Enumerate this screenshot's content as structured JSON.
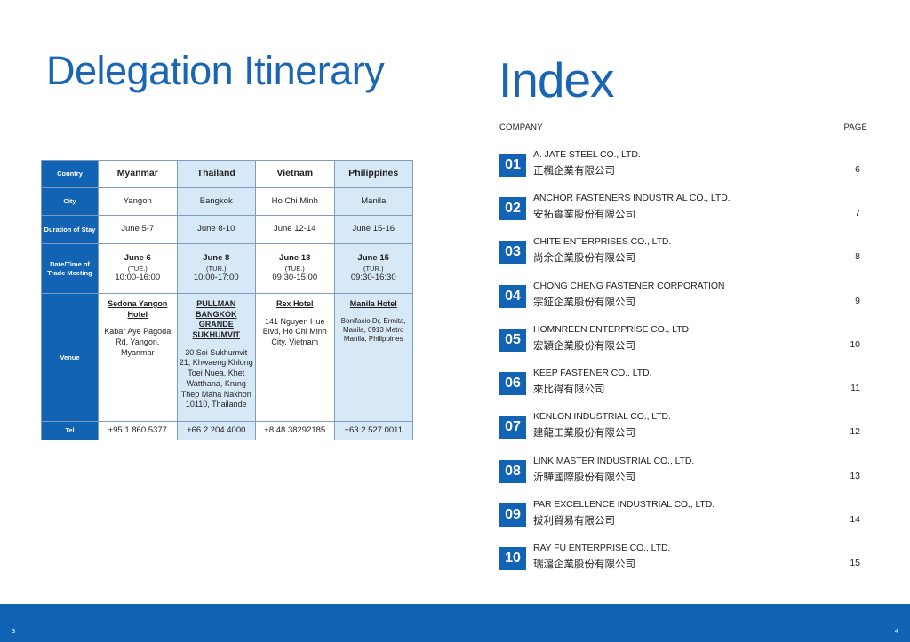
{
  "itinerary": {
    "title": "Delegation Itinerary",
    "row_labels": {
      "country": "Country",
      "city": "City",
      "duration": "Duration of Stay",
      "date_time": "Date/Time of Trade Meeting",
      "venue": "Venue",
      "tel": "Tel"
    },
    "columns": [
      {
        "country": "Myanmar",
        "city": "Yangon",
        "duration": "June 5-7",
        "date": "June 6",
        "weekday": "(TUE.)",
        "time": "10:00-16:00",
        "hotel": "Sedona Yangon Hotel",
        "address": "Kabar Aye Pagoda Rd, Yangon, Myanmar",
        "tel": "+95 1 860 5377"
      },
      {
        "country": "Thailand",
        "city": "Bangkok",
        "duration": "June 8-10",
        "date": "June 8",
        "weekday": "(TUR.)",
        "time": "10:00-17:00",
        "hotel": "PULLMAN BANGKOK GRANDE SUKHUMVIT",
        "address": "30 Soi Sukhumvit 21, Khwaeng Khlong Toei Nuea, Khet Watthana, Krung Thep Maha Nakhon 10110, Thailande",
        "tel": "+66 2 204 4000"
      },
      {
        "country": "Vietnam",
        "city": "Ho Chi Minh",
        "duration": "June 12-14",
        "date": "June 13",
        "weekday": "(TUE.)",
        "time": "09:30-15:00",
        "hotel": "Rex Hotel",
        "address": "141 Nguyen Hue Blvd, Ho Chi Minh City, Vietnam",
        "tel": "+8 48 38292185"
      },
      {
        "country": "Philippines",
        "city": "Manila",
        "duration": "June 15-16",
        "date": "June 15",
        "weekday": "(TUR.)",
        "time": "09:30-16:30",
        "hotel": "Manila Hotel",
        "address": "Bonifacio Dr, Ermita, Manila, 0913 Metro Manila, Philippines",
        "tel": "+63 2 527 0011"
      }
    ]
  },
  "index": {
    "title": "Index",
    "col_company": "COMPANY",
    "col_page": "PAGE",
    "entries": [
      {
        "num": "01",
        "en": "A. JATE STEEL CO., LTD.",
        "zh": "正楓企業有限公司",
        "page": "6"
      },
      {
        "num": "02",
        "en": "ANCHOR FASTENERS INDUSTRIAL CO., LTD.",
        "zh": "安拓實業股份有限公司",
        "page": "7"
      },
      {
        "num": "03",
        "en": "CHITE ENTERPRISES CO., LTD.",
        "zh": "尚余企業股份有限公司",
        "page": "8"
      },
      {
        "num": "04",
        "en": "CHONG CHENG FASTENER CORPORATION",
        "zh": "宗鉦企業股份有限公司",
        "page": "9"
      },
      {
        "num": "05",
        "en": "HOMNREEN ENTERPRISE CO., LTD.",
        "zh": "宏穎企業股份有限公司",
        "page": "10"
      },
      {
        "num": "06",
        "en": "KEEP FASTENER CO., LTD.",
        "zh": "來比得有限公司",
        "page": "11"
      },
      {
        "num": "07",
        "en": "KENLON INDUSTRIAL CO., LTD.",
        "zh": "建龍工業股份有限公司",
        "page": "12"
      },
      {
        "num": "08",
        "en": "LINK MASTER INDUSTRIAL CO., LTD.",
        "zh": "沂驊國際股份有限公司",
        "page": "13"
      },
      {
        "num": "09",
        "en": "PAR EXCELLENCE INDUSTRIAL CO., LTD.",
        "zh": "拔利貿易有限公司",
        "page": "14"
      },
      {
        "num": "10",
        "en": "RAY FU ENTERPRISE CO., LTD.",
        "zh": "瑞滬企業股份有限公司",
        "page": "15"
      }
    ]
  },
  "footer": {
    "left_page": "3",
    "right_page": "4",
    "color": "#1263b4"
  },
  "colors": {
    "accent": "#1a66b5",
    "table_header": "#1263b4",
    "alt_column": "#d7e8f7"
  }
}
